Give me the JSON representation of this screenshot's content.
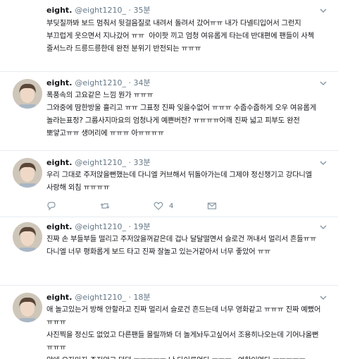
{
  "tweets": [
    {
      "name": "eight.",
      "handle": "@eight1210_",
      "time": "· 35분",
      "text": "부딪칠까봐 보드 멈춰서 뒷걸음질로 내려서 돌려서 갔어ㅠㅠ 내가 다넬티입어서 그런지 부끄럽게 웃으면서 지나갔어 ㅠㅠ  아이팟 끼고 엄청 여유롭게 타는데 반대편에 팬들이 사첵 줄서느라 드릉드릉한데 완전 분위기 반전되는 ㅠㅠㅠ"
    },
    {
      "name": "eight.",
      "handle": "@eight1210_",
      "time": "· 34분",
      "text": "폭풍속의 고요같은 느낌 뭔가 ㅠㅠㅠ\n그와중에 땀한방울 흘리고 ㅠㅠ 그표정 진짜 잊을수없어 ㅠㅠㅠ 수줍수줍하게 오우 여유롭게 놀라는표정? 그룹사지마요의 엄청나게 예쁜버전? ㅠㅠㅠㅠ어깨 진짜 넓고 피부도 완전 뽀얗고ㅠㅠ 생머리에 ㅠㅠㅠ 아ㅠㅠㅠㅠ"
    },
    {
      "name": "eight.",
      "handle": "@eight1210_",
      "time": "· 33분",
      "text": "우리 그대로 주저앉을뻔했는데 다니엘 커브해서 뒤돌아가는데 그제야 정신챙기고 강다니엘 사랑해 외침 ㅠㅠㅠㅠ",
      "retweets": "",
      "likes": "4"
    },
    {
      "name": "eight.",
      "handle": "@eight1210_",
      "time": "· 19분",
      "text": "진짜 손 부들부들 떨리고 주저앉을꺼같은데 겁나 달달떨면서 슬로건 꺼내서 멀리서 흔들ㅠㅠ 다니엘 너무 평화롭게 보드 타고 진짜 잘놀고 있는거같아서 너무 좋았어 ㅠㅠ"
    },
    {
      "name": "eight.",
      "handle": "@eight1210_",
      "time": "· 18분",
      "text": "애 놀고있는거 방해 안할라고 진짜 멀리서 슬로건 흔드는데 너무 영화같고 ㅠㅠㅠ 진짜 예뻤어 ㅠㅠㅠ\n사진찍을 정신도 없었고 다른팬들 몰릴까봐 더 놀게놔두고싶어서 조용히나오는데 기어나올뻔 ㅠㅠㅠ\n앞에 오자마자 주저앉고 덜덜 ㅠㅠㅠㅠㅠ 난 다이루었다 ㅠㅠㅠ...여한이없다 ㅠㅠㅠㅠㅠ"
    }
  ],
  "icons": {
    "menu": "chevron-down-icon",
    "reply": "reply-icon",
    "retweet": "retweet-icon",
    "like": "heart-icon",
    "dm": "mail-icon"
  },
  "colors": {
    "text": "#14171a",
    "muted": "#657786",
    "divider": "#e6ecf0"
  }
}
